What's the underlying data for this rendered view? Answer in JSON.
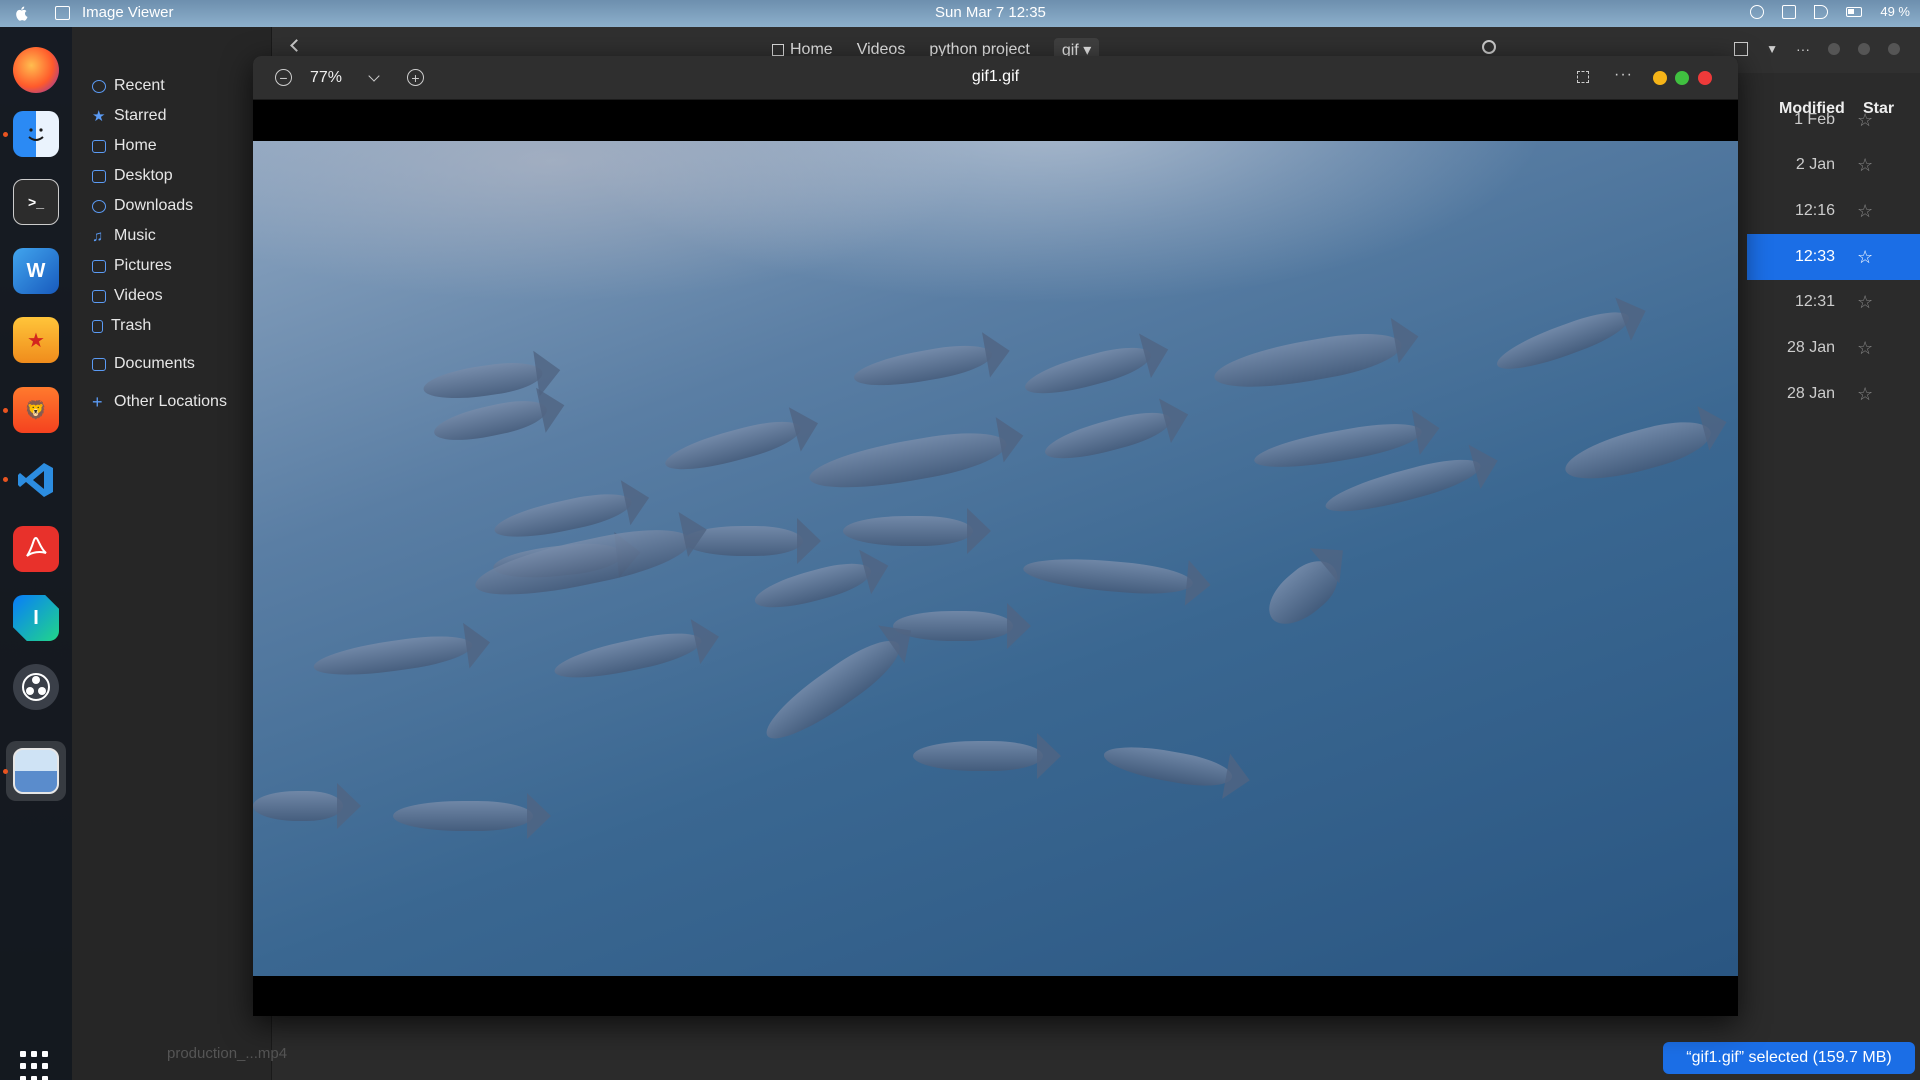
{
  "topbar": {
    "app_name": "Image Viewer",
    "clock": "Sun Mar 7  12:35",
    "battery": "49 %"
  },
  "dock": {
    "items": [
      "firefox-icon",
      "finder-icon",
      "terminal-icon",
      "word-icon",
      "hub-icon",
      "brave-icon",
      "vscode-icon",
      "acrobat-icon",
      "intellij-icon",
      "obs-icon",
      "image-viewer-icon"
    ],
    "grid_label": "Show Applications"
  },
  "files": {
    "sidebar": [
      {
        "label": "Recent",
        "icon": "clock-icon"
      },
      {
        "label": "Starred",
        "icon": "star-icon"
      },
      {
        "label": "Home",
        "icon": "home-icon"
      },
      {
        "label": "Desktop",
        "icon": "desktop-icon"
      },
      {
        "label": "Downloads",
        "icon": "download-icon"
      },
      {
        "label": "Music",
        "icon": "music-icon"
      },
      {
        "label": "Pictures",
        "icon": "pictures-icon"
      },
      {
        "label": "Videos",
        "icon": "videos-icon"
      },
      {
        "label": "Trash",
        "icon": "trash-icon"
      },
      {
        "label": "Documents",
        "icon": "folder-icon"
      },
      {
        "label": "Other Locations",
        "icon": "plus-icon"
      }
    ],
    "breadcrumbs": [
      "Home",
      "Videos",
      "python project",
      "gif"
    ],
    "columns": {
      "modified": "Modified",
      "star": "Star"
    },
    "rows": [
      {
        "modified": "1 Feb",
        "selected": false
      },
      {
        "modified": "2 Jan",
        "selected": false
      },
      {
        "modified": "12:16",
        "selected": false
      },
      {
        "modified": "12:33",
        "selected": true
      },
      {
        "modified": "12:31",
        "selected": false
      },
      {
        "modified": "28 Jan",
        "selected": false
      },
      {
        "modified": "28 Jan",
        "selected": false
      }
    ],
    "status": "“gif1.gif” selected  (159.7 MB)"
  },
  "viewer": {
    "zoom": "77%",
    "title": "gif1.gif",
    "zoom_out": "−",
    "zoom_in": "+",
    "more": "···",
    "colors": {
      "minimize": "#f5b418",
      "maximize": "#40c040",
      "close": "#ee3a3a",
      "accent": "#1b6ee6"
    }
  }
}
